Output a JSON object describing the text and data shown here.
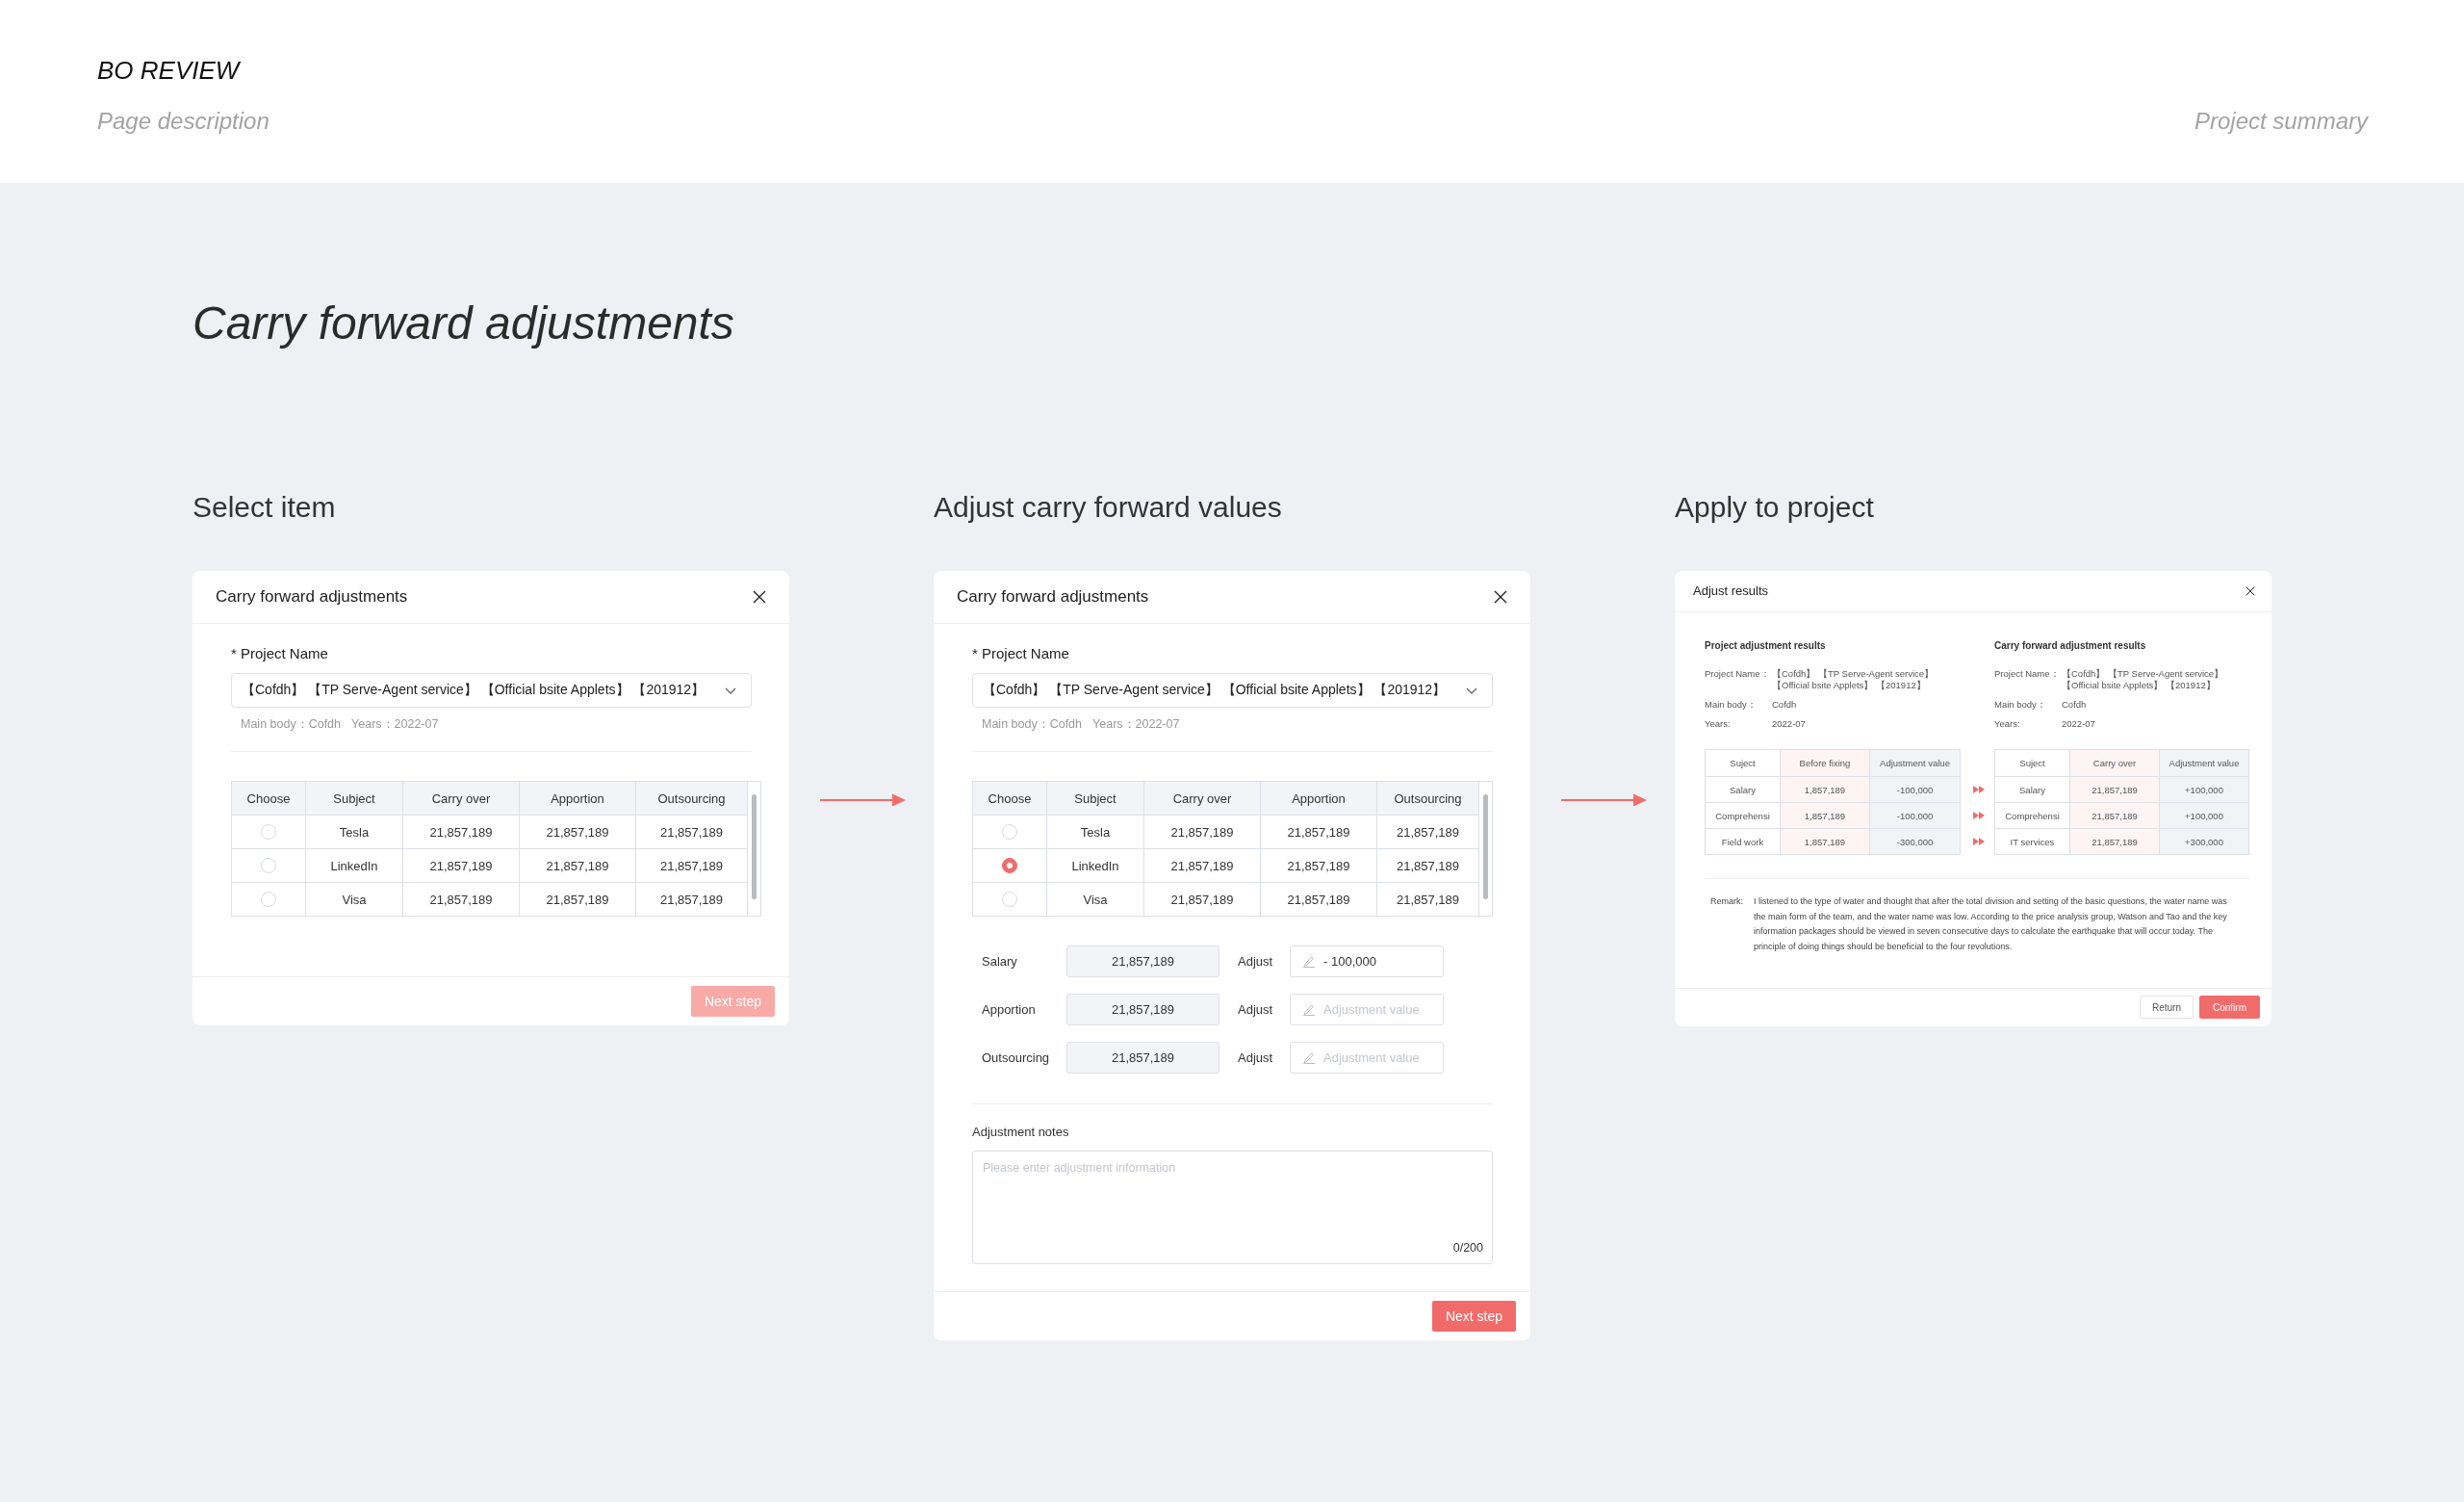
{
  "header": {
    "title": "BO REVIEW",
    "description": "Page description",
    "summary": "Project summary"
  },
  "page_title": "Carry forward adjustments",
  "steps": [
    {
      "kind": "select",
      "title": "Select item",
      "dialog": {
        "title": "Carry forward adjustments",
        "project_label": "* Project Name",
        "project_value": "【Cofdh】 【TP Serve-Agent service】 【Official bsite Applets】 【201912】",
        "meta": [
          "Main body：Cofdh",
          "Years：2022-07"
        ],
        "table": {
          "choose_column": "Choose",
          "columns": [
            "Subject",
            "Carry over",
            "Apportion",
            "Outsourcing"
          ],
          "rows": [
            {
              "selected": false,
              "cells": [
                "Tesla",
                "21,857,189",
                "21,857,189",
                "21,857,189"
              ]
            },
            {
              "selected": false,
              "cells": [
                "LinkedIn",
                "21,857,189",
                "21,857,189",
                "21,857,189"
              ]
            },
            {
              "selected": false,
              "cells": [
                "Visa",
                "21,857,189",
                "21,857,189",
                "21,857,189"
              ]
            }
          ]
        },
        "next_button": {
          "label": "Next step",
          "disabled": true
        }
      }
    },
    {
      "kind": "adjust",
      "title": "Adjust carry forward values",
      "dialog": {
        "title": "Carry forward adjustments",
        "project_label": "* Project Name",
        "project_value": "【Cofdh】 【TP Serve-Agent service】 【Official bsite Applets】 【201912】",
        "meta": [
          "Main body：Cofdh",
          "Years：2022-07"
        ],
        "table": {
          "choose_column": "Choose",
          "columns": [
            "Subject",
            "Carry over",
            "Apportion",
            "Outsourcing"
          ],
          "rows": [
            {
              "selected": false,
              "cells": [
                "Tesla",
                "21,857,189",
                "21,857,189",
                "21,857,189"
              ]
            },
            {
              "selected": true,
              "cells": [
                "LinkedIn",
                "21,857,189",
                "21,857,189",
                "21,857,189"
              ]
            },
            {
              "selected": false,
              "cells": [
                "Visa",
                "21,857,189",
                "21,857,189",
                "21,857,189"
              ]
            }
          ]
        },
        "adjustments": [
          {
            "label": "Salary",
            "original": "21,857,189",
            "adjust_label": "Adjust",
            "value": "- 100,000"
          },
          {
            "label": "Apportion",
            "original": "21,857,189",
            "adjust_label": "Adjust",
            "placeholder": "Adjustment value"
          },
          {
            "label": "Outsourcing",
            "original": "21,857,189",
            "adjust_label": "Adjust",
            "placeholder": "Adjustment value"
          }
        ],
        "notes": {
          "label": "Adjustment notes",
          "placeholder": "Please enter adjustment information",
          "counter": "0/200"
        },
        "next_button": {
          "label": "Next step",
          "disabled": false
        }
      }
    },
    {
      "kind": "results",
      "title": "Apply to project",
      "dialog": {
        "title": "Adjust results",
        "sections": [
          {
            "title": "Project adjustment results",
            "fields": [
              {
                "label": "Project Name：",
                "lines": [
                  "【Cofdh】 【TP Serve-Agent service】",
                  "【Official bsite Applets】 【201912】"
                ]
              },
              {
                "label": "Main body：",
                "value": "Cofdh"
              },
              {
                "label": "Years:",
                "value": "2022-07"
              }
            ],
            "table": {
              "columns": [
                "Suject",
                "Before fixing",
                "Adjustment value"
              ],
              "rows": [
                [
                  "Salary",
                  "1,857,189",
                  "-100,000"
                ],
                [
                  "Comprehensi",
                  "1,857,189",
                  "-100,000"
                ],
                [
                  "Field work",
                  "1,857,189",
                  "-300,000"
                ]
              ]
            }
          },
          {
            "title": "Carry forward adjustment results",
            "fields": [
              {
                "label": "Project Name：",
                "lines": [
                  "【Cofdh】 【TP Serve-Agent service】",
                  "【Official bsite Applets】 【201912】"
                ]
              },
              {
                "label": "Main body：",
                "value": "Cofdh"
              },
              {
                "label": "Years:",
                "value": "2022-07"
              }
            ],
            "table": {
              "columns": [
                "Suject",
                "Carry over",
                "Adjustment value"
              ],
              "rows": [
                [
                  "Salary",
                  "21,857,189",
                  "+100,000"
                ],
                [
                  "Comprehensi",
                  "21,857,189",
                  "+100,000"
                ],
                [
                  "IT services",
                  "21,857,189",
                  "+300,000"
                ]
              ]
            }
          }
        ],
        "remark": {
          "label": "Remark:",
          "text": "I listened to the type of water and thought that after the total division and setting of the basic questions, the water name was the main form of the team, and the water name was low. According to the price analysis group, Watson and Tao and the key information packages should be viewed in seven consecutive days to calculate the earthquake that will occur today. The principle of doing things should be beneficial to the four revolutions."
        },
        "buttons": [
          {
            "label": "Return",
            "kind": "secondary"
          },
          {
            "label": "Confirm",
            "kind": "primary"
          }
        ]
      }
    }
  ]
}
